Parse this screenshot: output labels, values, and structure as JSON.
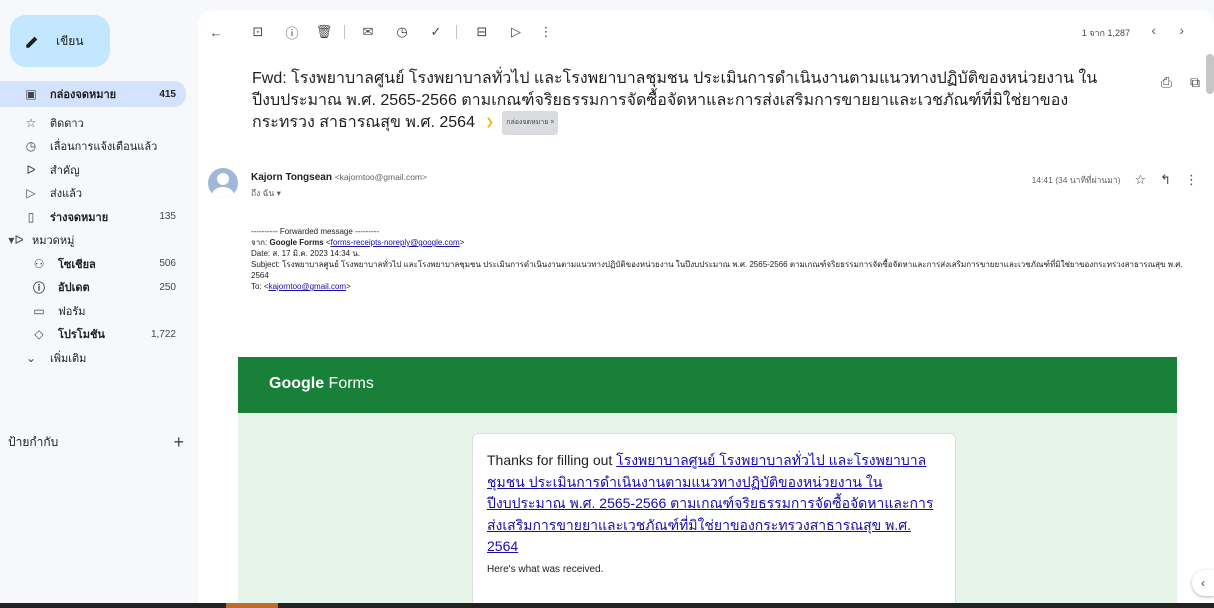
{
  "compose": {
    "label": "เขียน"
  },
  "sidebar": {
    "items": [
      {
        "label": "กล่องจดหมาย",
        "count": "415"
      },
      {
        "label": "ติดดาว",
        "count": ""
      },
      {
        "label": "เลื่อนการแจ้งเตือนแล้ว",
        "count": ""
      },
      {
        "label": "สำคัญ",
        "count": ""
      },
      {
        "label": "ส่งแล้ว",
        "count": ""
      },
      {
        "label": "ร่างจดหมาย",
        "count": "135"
      },
      {
        "label": "หมวดหมู่",
        "count": ""
      },
      {
        "label": "โซเชียล",
        "count": "506"
      },
      {
        "label": "อัปเดต",
        "count": "250"
      },
      {
        "label": "ฟอรัม",
        "count": ""
      },
      {
        "label": "โปรโมชัน",
        "count": "1,722"
      },
      {
        "label": "เพิ่มเติม",
        "count": ""
      }
    ],
    "labels_heading": "ป้ายกำกับ",
    "labels_add": "+"
  },
  "toolbar": {
    "pager_text": "1 จาก 1,287"
  },
  "email": {
    "subject": "Fwd: โรงพยาบาลศูนย์ โรงพยาบาลทั่วไป และโรงพยาบาลชุมชน ประเมินการดำเนินงานตามแนวทางปฏิบัติของหน่วยงาน ใน ปีงบประมาณ พ.ศ. 2565-2566 ตามเกณฑ์จริยธรรมการจัดซื้อจัดหาและการส่งเสริมการขายยาและเวชภัณฑ์ที่มิใช่ยาของกระทรวง สาธารณสุข พ.ศ. 2564",
    "label_chip": "กล่องจดหมาย ×",
    "sender_name": "Kajorn Tongsean",
    "sender_email": "<kajorntoo@gmail.com>",
    "to": "ถึง ฉัน ▾",
    "time": "14:41 (34 นาทีที่ผ่านมา)",
    "forwarded_header": "---------- Forwarded message ---------",
    "from_prefix": "จาก: ",
    "from_name": "Google Forms",
    "from_email": "forms-receipts-noreply@google.com",
    "date": "Date: ส. 17 มิ.ค. 2023 14:34 น.",
    "subject_line": "Subject: โรงพยาบาลศูนย์ โรงพยาบาลทั่วไป และโรงพยาบาลชุมชน ประเมินการดำเนินงานตามแนวทางปฏิบัติของหน่วยงาน ในปีงบประมาณ พ.ศ. 2565-2566 ตามเกณฑ์จริยธรรมการจัดซื้อจัดหาและการส่งเสริมการขายยาและเวชภัณฑ์ที่มิใช่ยาของกระทรวงสาธารณสุข พ.ศ. 2564",
    "to_prefix": "To: ",
    "to_email": "kajorntoo@gmail.com"
  },
  "gform": {
    "brand_bold": "Google",
    "brand_rest": " Forms",
    "thanks_prefix": "Thanks for filling out ",
    "form_title": "โรงพยาบาลศูนย์ โรงพยาบาลทั่วไป และโรงพยาบาลชุมชน ประเมินการดำเนินงานตามแนวทางปฏิบัติของหน่วยงาน ในปีงบประมาณ พ.ศ. 2565-2566 ตามเกณฑ์จริยธรรมการจัดซื้อจัดหาและการส่งเสริมการขายยาและเวชภัณฑ์ที่มิใช่ยาของกระทรวงสาธารณสุข พ.ศ. 2564",
    "received": "Here's what was received."
  }
}
